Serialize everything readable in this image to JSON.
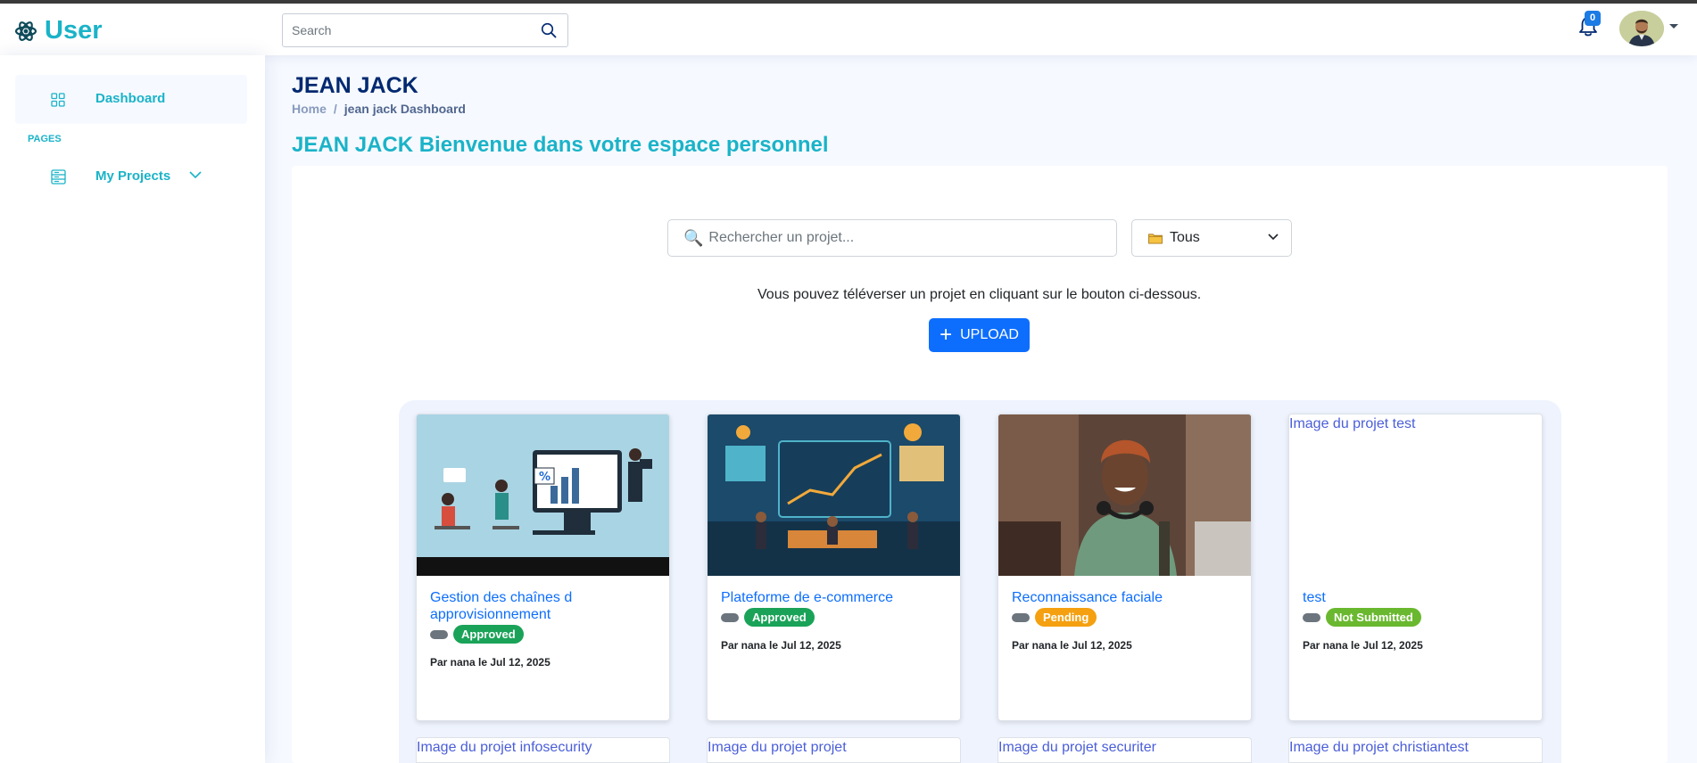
{
  "header": {
    "logo_text": "User",
    "search_placeholder": "Search",
    "notification_count": "0"
  },
  "sidebar": {
    "dashboard_label": "Dashboard",
    "section_heading": "PAGES",
    "projects_label": "My Projects"
  },
  "page": {
    "title": "JEAN JACK",
    "breadcrumb_home": "Home",
    "breadcrumb_sep": "/",
    "breadcrumb_current": "jean jack Dashboard",
    "welcome": "JEAN JACK Bienvenue dans votre espace personnel"
  },
  "toolbar": {
    "search_placeholder": "Rechercher un projet...",
    "filter_value": "Tous",
    "info_text": "Vous pouvez téléverser un projet en cliquant sur le bouton ci-dessous.",
    "upload_label": "UPLOAD",
    "primary_color": "#0d6efd",
    "accent_color": "#1ab3c8"
  },
  "projects": [
    {
      "title": "Gestion des chaînes d approvisionnement",
      "status": "Approved",
      "author": "Par nana le Jul 12, 2025"
    },
    {
      "title": "Plateforme de e-commerce",
      "status": "Approved",
      "author": "Par nana le Jul 12, 2025"
    },
    {
      "title": "Reconnaissance faciale",
      "status": "Pending",
      "author": "Par nana le Jul 12, 2025"
    },
    {
      "title": "test",
      "status": "Not Submitted",
      "author": "Par nana le Jul 12, 2025",
      "image_alt": "Image du projet test"
    }
  ],
  "more_projects": [
    {
      "image_alt": "Image du projet infosecurity"
    },
    {
      "image_alt": "Image du projet projet"
    },
    {
      "image_alt": "Image du projet securiter"
    },
    {
      "image_alt": "Image du projet christiantest"
    }
  ]
}
